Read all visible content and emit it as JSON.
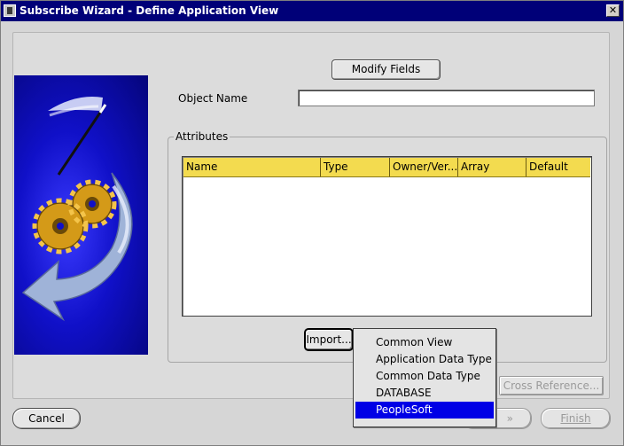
{
  "window": {
    "title": "Subscribe Wizard  - Define Application View",
    "close_icon": "close-icon"
  },
  "buttons": {
    "modify_fields": "Modify Fields",
    "import": "Import...",
    "cross_reference": "Cross Reference...",
    "cancel": "Cancel",
    "next_arrows": "»",
    "finish": "Finish"
  },
  "form": {
    "object_name_label": "Object Name",
    "object_name_value": "",
    "attributes_label": "Attributes"
  },
  "table": {
    "columns": [
      "Name",
      "Type",
      "Owner/Ver...",
      "Array",
      "Default"
    ],
    "header_color": "#f3db4f",
    "rows": []
  },
  "import_menu": {
    "items": [
      "Common View",
      "Application Data Type",
      "Common Data Type",
      "DATABASE",
      "PeopleSoft"
    ],
    "selected": "PeopleSoft",
    "selected_color": "#0000e6"
  },
  "illustration": {
    "icon": "gears-wand-arrow-icon"
  }
}
